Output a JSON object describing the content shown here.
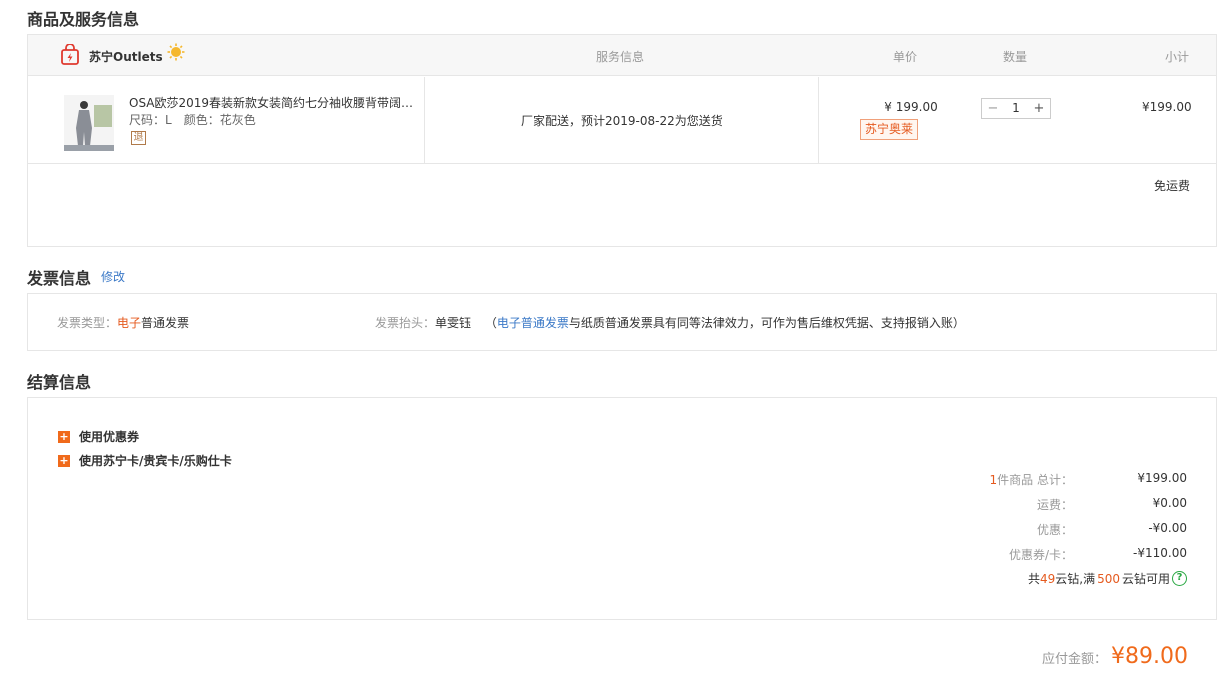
{
  "products_section": {
    "title": "商品及服务信息",
    "store_name": "苏宁Outlets",
    "columns": {
      "service": "服务信息",
      "price": "单价",
      "qty": "数量",
      "subtotal": "小计"
    },
    "item": {
      "name": "OSA欧莎2019春装新款女装简约七分袖收腰背带阔腿裤...",
      "size": "尺码：L",
      "color": "颜色：花灰色",
      "return_badge": "退",
      "delivery": "厂家配送，预计2019-08-22为您送货",
      "unit_price": "¥ 199.00",
      "promo_tag": "苏宁奥莱",
      "quantity": "1",
      "minus": "−",
      "plus": "+",
      "subtotal": "¥199.00"
    },
    "shipping": "免运费"
  },
  "invoice_section": {
    "title": "发票信息",
    "edit": "修改",
    "type_label": "发票类型：",
    "type_highlight": "电子",
    "type_rest": "普通发票",
    "header_label": "发票抬头：",
    "header_value": "单雯钰",
    "note_open": "（",
    "note_link": "电子普通发票",
    "note_rest": "与纸质普通发票具有同等法律效力，可作为售后维权凭据、支持报销入账）"
  },
  "settlement_section": {
    "title": "结算信息",
    "coupon_option": "使用优惠券",
    "card_option": "使用苏宁卡/贵宾卡/乐购仕卡",
    "summary": {
      "count": "1",
      "count_suffix": "件商品 总计：",
      "total": "¥199.00",
      "shipping_label": "运费：",
      "shipping_value": "¥0.00",
      "discount_label": "优惠：",
      "discount_value": "-¥0.00",
      "coupon_label": "优惠券/卡：",
      "coupon_value": "-¥110.00",
      "cloud_prefix": "共 ",
      "cloud_have": "49",
      "cloud_mid": "云钻,满",
      "cloud_min": "500",
      "cloud_suffix": "云钻可用",
      "help": "?"
    },
    "payable_label": "应付金额：",
    "payable_amount": "¥89.00"
  },
  "colors": {
    "accent": "#f06a1b",
    "link": "#3b79c7",
    "border": "#e6e6e6",
    "help": "#2aa843"
  },
  "icons": {
    "store": "shopping-bag-icon",
    "store_badge": "sun-badge-icon",
    "option": "plus-square-icon"
  }
}
